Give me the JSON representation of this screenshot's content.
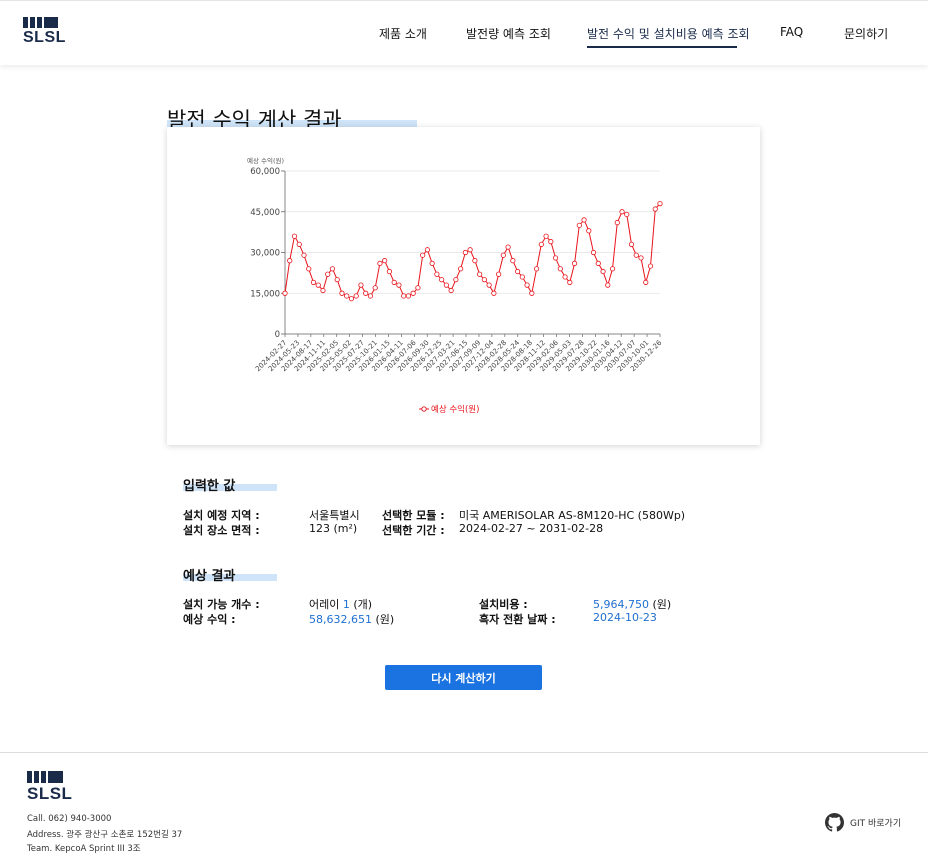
{
  "header": {
    "logo_text": "SLSL",
    "nav": [
      "제품 소개",
      "발전량 예측 조회",
      "발전 수익 및 설치비용 예측 조회",
      "FAQ",
      "문의하기"
    ],
    "active_index": 2
  },
  "page": {
    "title": "발전 수익 계산 결과"
  },
  "chart_data": {
    "type": "line",
    "ylabel": "예상 수익(원)",
    "ylim": [
      0,
      60000
    ],
    "yticks": [
      "0",
      "15,000",
      "30,000",
      "45,000",
      "60,000"
    ],
    "xticks": [
      "2024-02-27",
      "2024-05-23",
      "2024-08-17",
      "2024-11-11",
      "2025-02-05",
      "2025-05-02",
      "2025-07-27",
      "2025-10-21",
      "2026-01-15",
      "2026-04-11",
      "2026-07-06",
      "2026-09-30",
      "2026-12-25",
      "2027-03-21",
      "2027-06-15",
      "2027-09-09",
      "2027-12-04",
      "2028-02-28",
      "2028-05-24",
      "2028-08-18",
      "2028-11-12",
      "2029-02-06",
      "2029-05-03",
      "2029-07-28",
      "2029-10-22",
      "2030-01-16",
      "2030-04-12",
      "2030-07-07",
      "2030-10-01",
      "2030-12-26"
    ],
    "series": [
      {
        "name": "예상 수익(원)",
        "color": "#e8141c",
        "values": [
          15000,
          27000,
          36000,
          33000,
          29000,
          24000,
          19000,
          18000,
          16000,
          22000,
          24000,
          20000,
          15000,
          14000,
          13000,
          14000,
          18000,
          15000,
          14000,
          17000,
          26000,
          27000,
          23000,
          19000,
          18000,
          14000,
          14000,
          15000,
          17000,
          29000,
          31000,
          26000,
          22000,
          20000,
          18000,
          16000,
          20000,
          24000,
          30000,
          31000,
          27000,
          22000,
          20000,
          18000,
          15000,
          22000,
          29000,
          32000,
          27000,
          23000,
          21000,
          18000,
          15000,
          24000,
          33000,
          36000,
          34000,
          28000,
          24000,
          21000,
          19000,
          26000,
          40000,
          42000,
          38000,
          30000,
          26000,
          23000,
          18000,
          24000,
          41000,
          45000,
          44000,
          33000,
          29000,
          28000,
          19000,
          25000,
          46000,
          48000
        ]
      }
    ],
    "legend_position": "bottom"
  },
  "inputs": {
    "title": "입력한 값",
    "region_label": "설치 예정 지역 :",
    "region_value": "서울특별시",
    "area_label": "설치 장소 면적 :",
    "area_value": "123 (m²)",
    "module_label": "선택한 모듈 :",
    "module_value": "미국 AMERISOLAR AS-8M120-HC (580Wp)",
    "period_label": "선택한 기간 :",
    "period_value": "2024-02-27 ~ 2031-02-28"
  },
  "results": {
    "title": "예상 결과",
    "count_label": "설치 가능 개수 :",
    "count_prefix": "어레이",
    "count_value": "1",
    "count_unit": "(개)",
    "revenue_label": "예상 수익 :",
    "revenue_value": "58,632,651",
    "revenue_unit": "(원)",
    "cost_label": "설치비용 :",
    "cost_value": "5,964,750",
    "cost_unit": "(원)",
    "breakeven_label": "흑자 전환 날짜 :",
    "breakeven_value": "2024-10-23"
  },
  "actions": {
    "recalc_label": "다시 계산하기"
  },
  "footer": {
    "logo_text": "SLSL",
    "call": "Call. 062) 940-3000",
    "address": "Address. 광주 광산구 소촌로 152번길 37",
    "team": "Team. KepcoA Sprint III 3조",
    "git_label": "GIT 바로가기"
  }
}
